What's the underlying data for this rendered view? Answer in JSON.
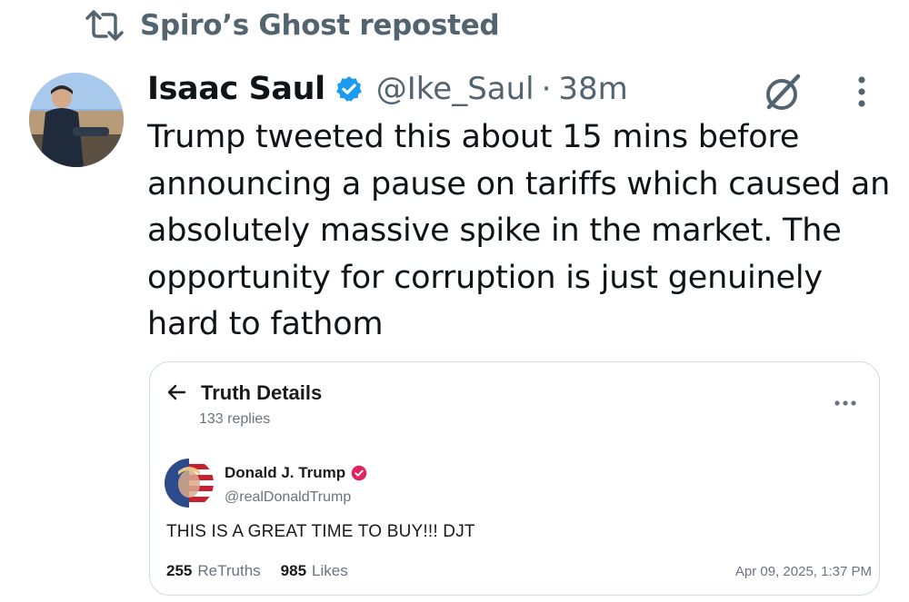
{
  "repost": {
    "icon": "repost-icon",
    "text": "Spiro’s Ghost reposted"
  },
  "tweet": {
    "author_name": "Isaac Saul",
    "verified_icon": "verified-badge-icon",
    "handle": "@Ike_Saul",
    "separator": "·",
    "time": "38m",
    "text": "Trump tweeted this about 15 mins before announcing a pause on tariffs which caused an absolutely massive spike in the market. The opportunity for corruption is just genuinely hard to fathom",
    "grok_icon": "grok-icon",
    "more_icon": "more-vertical-icon"
  },
  "quoted_card": {
    "header": {
      "back_icon": "arrow-left-icon",
      "title": "Truth Details",
      "replies": "133 replies",
      "more_icon": "more-horizontal-icon"
    },
    "post": {
      "author_name": "Donald J. Trump",
      "handle": "@realDonaldTrump",
      "text": "THIS IS A GREAT TIME TO BUY!!! DJT",
      "retruths_count": "255",
      "retruths_label": "ReTruths",
      "likes_count": "985",
      "likes_label": "Likes",
      "date": "Apr 09, 2025, 1:37 PM"
    }
  },
  "colors": {
    "text_primary": "#0f1419",
    "text_secondary": "#536471",
    "verified_blue": "#1d9bf0",
    "truth_verified": "#e0245e",
    "border": "#cfd9de"
  }
}
